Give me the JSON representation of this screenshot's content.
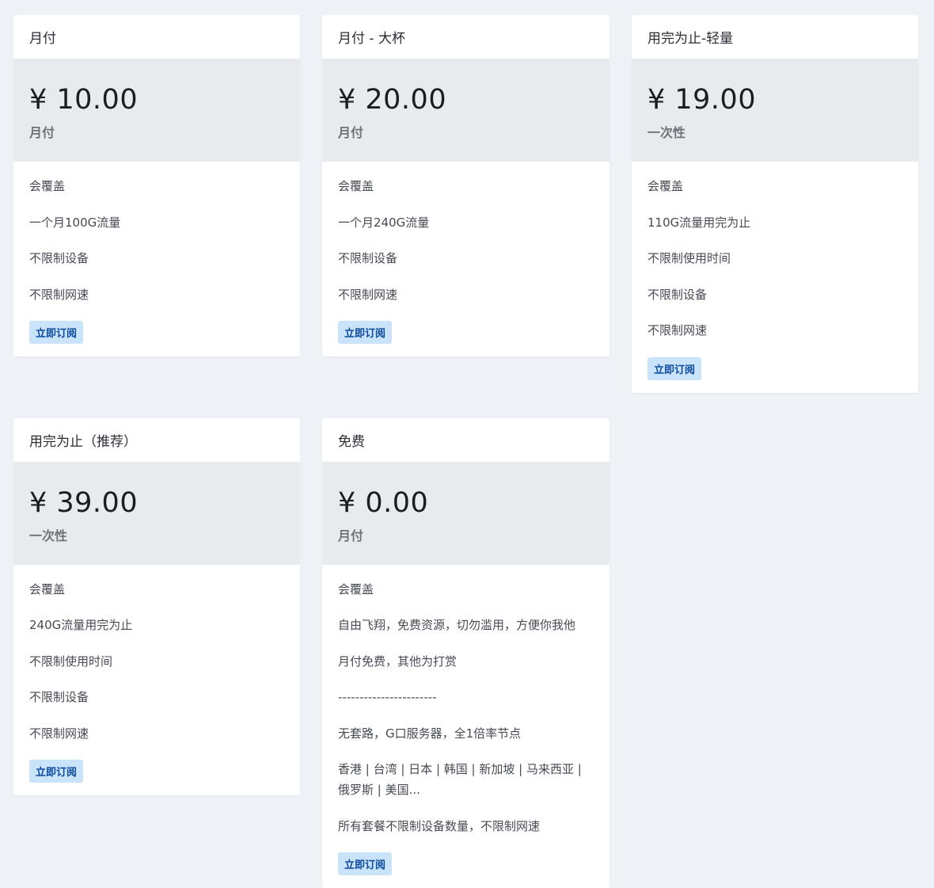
{
  "subscribe_label": "立即订阅",
  "plans": [
    {
      "name": "月付",
      "price": "¥ 10.00",
      "cycle": "月付",
      "features": [
        "会覆盖",
        "一个月100G流量",
        "不限制设备",
        "不限制网速"
      ]
    },
    {
      "name": "月付 - 大杯",
      "price": "¥ 20.00",
      "cycle": "月付",
      "features": [
        "会覆盖",
        "一个月240G流量",
        "不限制设备",
        "不限制网速"
      ]
    },
    {
      "name": "用完为止-轻量",
      "price": "¥ 19.00",
      "cycle": "一次性",
      "features": [
        "会覆盖",
        "110G流量用完为止",
        "不限制使用时间",
        "不限制设备",
        "不限制网速"
      ]
    },
    {
      "name": "用完为止（推荐）",
      "price": "¥ 39.00",
      "cycle": "一次性",
      "features": [
        "会覆盖",
        "240G流量用完为止",
        "不限制使用时间",
        "不限制设备",
        "不限制网速"
      ]
    },
    {
      "name": "免费",
      "price": "¥ 0.00",
      "cycle": "月付",
      "features": [
        "会覆盖",
        "自由飞翔，免费资源，切勿滥用，方便你我他",
        "月付免费，其他为打赏",
        "-----------------------",
        "无套路，G口服务器，全1倍率节点",
        "香港 | 台湾 | 日本 | 韩国 | 新加坡 | 马来西亚 | 俄罗斯 | 美国...",
        "所有套餐不限制设备数量，不限制网速"
      ]
    }
  ],
  "colors": {
    "page_background": "#eef2f7",
    "price_block": "#e8ebee",
    "button_background": "#c9e3fb",
    "button_text": "#0c4a9e"
  }
}
